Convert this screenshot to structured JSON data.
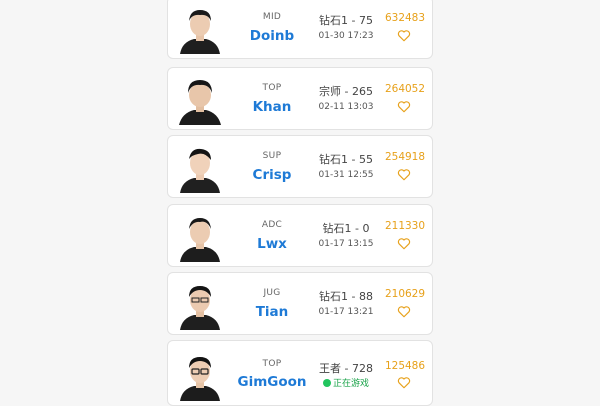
{
  "players": [
    {
      "role": "MID",
      "name": "Doinb",
      "rank": "钻石1 - 75",
      "time": "01-30 17:23",
      "status": "",
      "score": "632483",
      "fav_icon": "heart-outline-icon"
    },
    {
      "role": "TOP",
      "name": "Khan",
      "rank": "宗师 - 265",
      "time": "02-11 13:03",
      "status": "",
      "score": "264052",
      "fav_icon": "heart-outline-icon"
    },
    {
      "role": "SUP",
      "name": "Crisp",
      "rank": "钻石1 - 55",
      "time": "01-31 12:55",
      "status": "",
      "score": "254918",
      "fav_icon": "heart-outline-icon"
    },
    {
      "role": "ADC",
      "name": "Lwx",
      "rank": "钻石1 - 0",
      "time": "01-17 13:15",
      "status": "",
      "score": "211330",
      "fav_icon": "heart-outline-icon"
    },
    {
      "role": "JUG",
      "name": "Tian",
      "rank": "钻石1 - 88",
      "time": "01-17 13:21",
      "status": "",
      "score": "210629",
      "fav_icon": "heart-outline-icon"
    },
    {
      "role": "TOP",
      "name": "GimGoon",
      "rank": "王者 - 728",
      "time": "",
      "status": "正在游戏",
      "score": "125486",
      "fav_icon": "heart-outline-icon"
    }
  ],
  "colors": {
    "name": "#1e7ad6",
    "score": "#e7a11b",
    "heart": "#e7a11b",
    "online": "#22c55e"
  }
}
